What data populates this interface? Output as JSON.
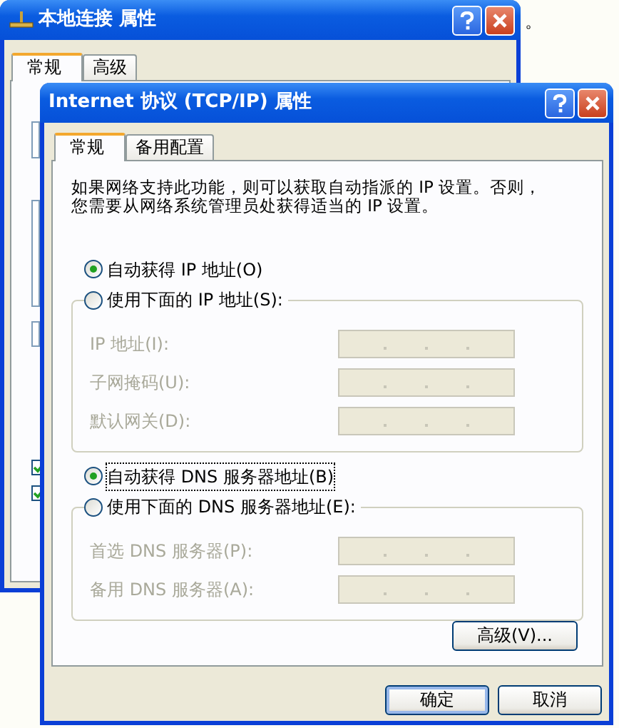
{
  "page_text": "。",
  "back_window": {
    "title": "本地连接 属性",
    "tabs": [
      {
        "label": "常规",
        "selected": true
      },
      {
        "label": "高级",
        "selected": false
      }
    ],
    "checkboxes": [
      {
        "checked": true
      },
      {
        "checked": true
      }
    ]
  },
  "dialog": {
    "title": "Internet 协议 (TCP/IP) 属性",
    "tabs": [
      {
        "label": "常规",
        "selected": true
      },
      {
        "label": "备用配置",
        "selected": false
      }
    ],
    "intro_lines": [
      "如果网络支持此功能，则可以获取自动指派的 IP 设置。否则，",
      "您需要从网络系统管理员处获得适当的 IP 设置。"
    ],
    "ip_options": [
      {
        "label": "自动获得 IP 地址(O)",
        "selected": true,
        "focused": false
      },
      {
        "label": "使用下面的 IP 地址(S):",
        "selected": false,
        "focused": false
      }
    ],
    "ip_fields": [
      {
        "label": "IP 地址(I):",
        "disabled": true
      },
      {
        "label": "子网掩码(U):",
        "disabled": true
      },
      {
        "label": "默认网关(D):",
        "disabled": true
      }
    ],
    "dns_options": [
      {
        "label": "自动获得 DNS 服务器地址(B)",
        "selected": true,
        "focused": true
      },
      {
        "label": "使用下面的 DNS 服务器地址(E):",
        "selected": false,
        "focused": false
      }
    ],
    "dns_fields": [
      {
        "label": "首选 DNS 服务器(P):",
        "disabled": true
      },
      {
        "label": "备用 DNS 服务器(A):",
        "disabled": true
      }
    ],
    "advanced_button": "高级(V)...",
    "buttons": [
      {
        "label": "确定",
        "default": true
      },
      {
        "label": "取消",
        "default": false
      }
    ]
  }
}
